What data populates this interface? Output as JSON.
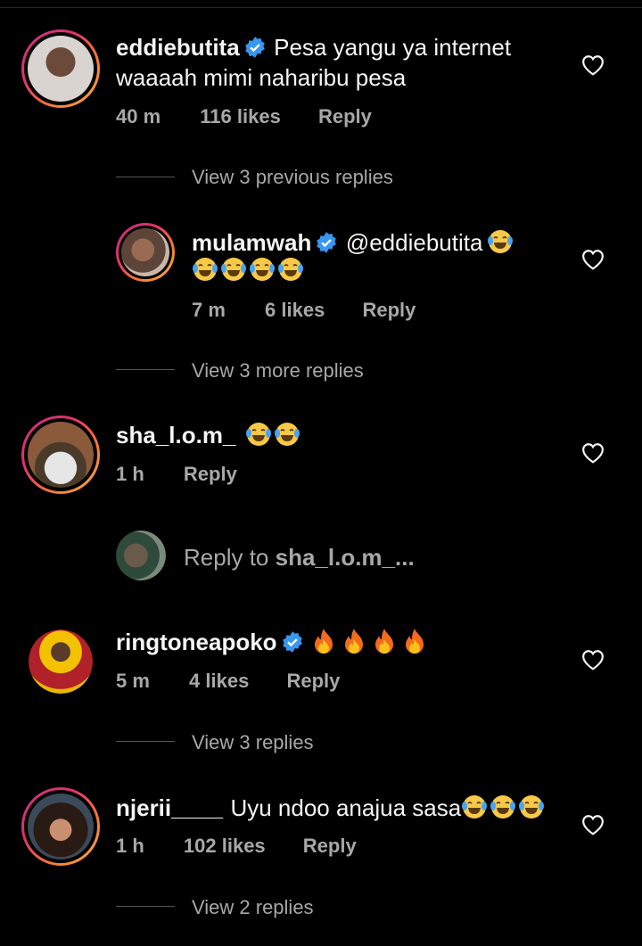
{
  "comments": [
    {
      "username": "eddiebutita",
      "line1": "Pesa yangu ya internet",
      "line2": "waaaah mimi naharibu pesa",
      "time": "40 m",
      "likes": "116 likes",
      "reply": "Reply",
      "view_replies": "View 3 previous replies"
    },
    {
      "username": "mulamwah",
      "mention": "@eddiebutita",
      "time": "7 m",
      "likes": "6 likes",
      "reply": "Reply",
      "view_replies": "View 3 more replies"
    },
    {
      "username": "sha_l.o.m_",
      "time": "1 h",
      "reply": "Reply"
    },
    {
      "username": "ringtoneapoko",
      "time": "5 m",
      "likes": "4 likes",
      "reply": "Reply",
      "view_replies": "View 3 replies"
    },
    {
      "username": "njerii____",
      "text": "Uyu ndoo anajua sasa",
      "time": "1 h",
      "likes": "102 likes",
      "reply": "Reply",
      "view_replies": "View 2 replies"
    }
  ],
  "reply_box": {
    "prefix": "Reply to ",
    "target": "sha_l.o.m_..."
  },
  "colors": {
    "verified": "#3897f0",
    "background": "#000000",
    "muted": "#a8a8a8"
  }
}
